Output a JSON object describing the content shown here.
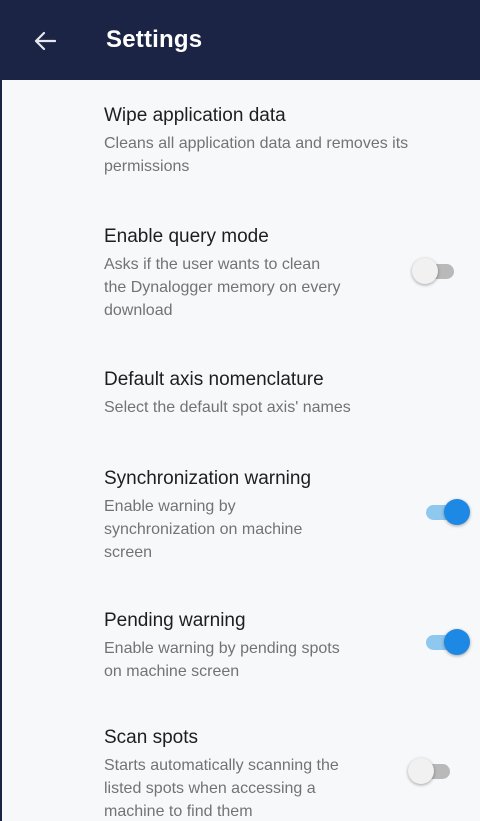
{
  "appbar": {
    "title": "Settings",
    "back_icon": "arrow-back-icon",
    "background": "#1b2445"
  },
  "accent_color": "#1e88e5",
  "settings": [
    {
      "title": "Wipe application data",
      "summary_lines": [
        "Cleans all application data and removes its",
        "permissions"
      ],
      "has_toggle": false
    },
    {
      "title": "Enable query mode",
      "summary_lines": [
        "Asks if the user wants to clean",
        "the Dynalogger memory on every",
        "download"
      ],
      "has_toggle": true,
      "toggle_on": false
    },
    {
      "title": "Default axis nomenclature",
      "summary_lines": [
        "Select the default spot axis' names"
      ],
      "has_toggle": false
    },
    {
      "title": "Synchronization warning",
      "summary_lines": [
        "Enable warning by",
        "synchronization on machine",
        "screen"
      ],
      "has_toggle": true,
      "toggle_on": true
    },
    {
      "title": "Pending warning",
      "summary_lines": [
        "Enable warning by pending spots",
        "on machine screen"
      ],
      "has_toggle": true,
      "toggle_on": true
    },
    {
      "title": "Scan spots",
      "summary_lines": [
        "Starts automatically scanning the",
        "listed spots when accessing a",
        "machine to find them"
      ],
      "has_toggle": true,
      "toggle_on": false
    }
  ]
}
